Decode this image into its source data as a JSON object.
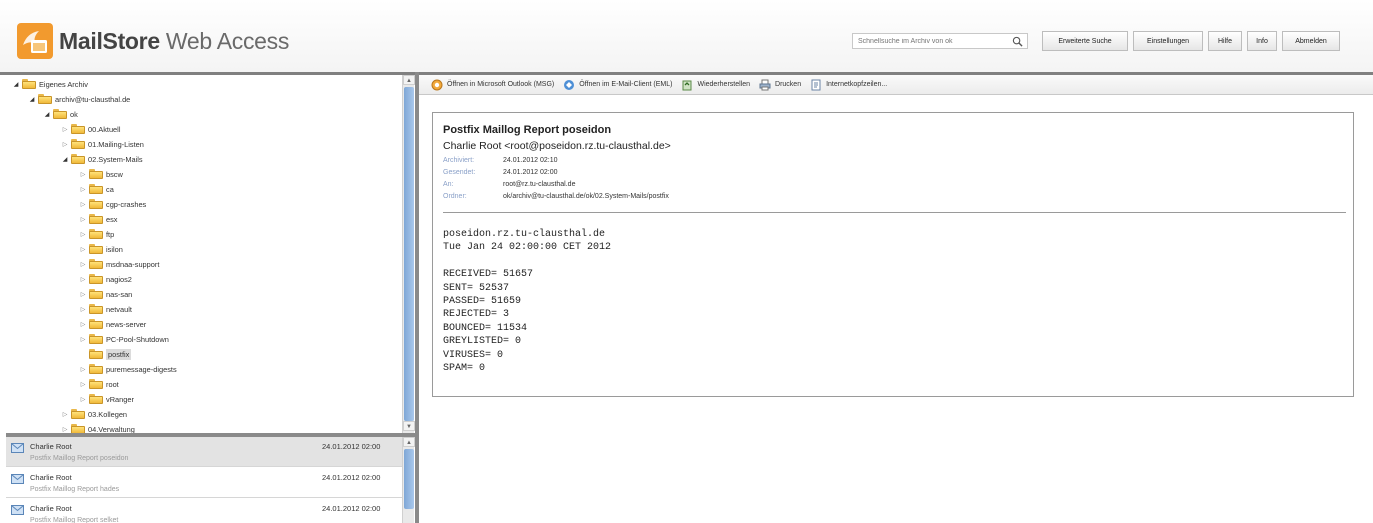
{
  "header": {
    "logo_bold": "MailStore",
    "logo_thin": "Web Access",
    "search_placeholder": "Schnellsuche im Archiv von ok",
    "buttons": [
      "Erweiterte Suche",
      "Einstellungen",
      "Hilfe",
      "Info",
      "Abmelden"
    ]
  },
  "tree": [
    {
      "label": "Eigenes Archiv",
      "depth": 0,
      "state": "open"
    },
    {
      "label": "archiv@tu-clausthal.de",
      "depth": 1,
      "state": "open"
    },
    {
      "label": "ok",
      "depth": 2,
      "state": "open"
    },
    {
      "label": "00.Aktuell",
      "depth": 3,
      "state": "closed"
    },
    {
      "label": "01.Mailing-Listen",
      "depth": 3,
      "state": "closed"
    },
    {
      "label": "02.System-Mails",
      "depth": 3,
      "state": "open"
    },
    {
      "label": "bscw",
      "depth": 4,
      "state": "closed"
    },
    {
      "label": "ca",
      "depth": 4,
      "state": "closed"
    },
    {
      "label": "cgp-crashes",
      "depth": 4,
      "state": "closed"
    },
    {
      "label": "esx",
      "depth": 4,
      "state": "closed"
    },
    {
      "label": "ftp",
      "depth": 4,
      "state": "closed"
    },
    {
      "label": "isilon",
      "depth": 4,
      "state": "closed"
    },
    {
      "label": "msdnaa-support",
      "depth": 4,
      "state": "closed"
    },
    {
      "label": "nagios2",
      "depth": 4,
      "state": "closed"
    },
    {
      "label": "nas-san",
      "depth": 4,
      "state": "closed"
    },
    {
      "label": "netvault",
      "depth": 4,
      "state": "closed"
    },
    {
      "label": "news-server",
      "depth": 4,
      "state": "closed"
    },
    {
      "label": "PC-Pool-Shutdown",
      "depth": 4,
      "state": "closed"
    },
    {
      "label": "postfix",
      "depth": 4,
      "state": "leaf",
      "selected": true
    },
    {
      "label": "puremessage-digests",
      "depth": 4,
      "state": "closed"
    },
    {
      "label": "root",
      "depth": 4,
      "state": "closed"
    },
    {
      "label": "vRanger",
      "depth": 4,
      "state": "closed"
    },
    {
      "label": "03.Kollegen",
      "depth": 3,
      "state": "closed"
    },
    {
      "label": "04.Verwaltung",
      "depth": 3,
      "state": "closed"
    }
  ],
  "mails": [
    {
      "from": "Charlie Root",
      "date": "24.01.2012 02:00",
      "subject": "Postfix Maillog Report poseidon",
      "selected": true
    },
    {
      "from": "Charlie Root",
      "date": "24.01.2012 02:00",
      "subject": "Postfix Maillog Report hades",
      "selected": false
    },
    {
      "from": "Charlie Root",
      "date": "24.01.2012 02:00",
      "subject": "Postfix Maillog Report selket",
      "selected": false
    }
  ],
  "toolbar": [
    {
      "label": "Öffnen in Microsoft Outlook (MSG)",
      "icon": "outlook-icon"
    },
    {
      "label": "Öffnen im E-Mail-Client (EML)",
      "icon": "email-client-icon"
    },
    {
      "label": "Wiederherstellen",
      "icon": "restore-icon"
    },
    {
      "label": "Drucken",
      "icon": "printer-icon"
    },
    {
      "label": "Internetkopfzeilen...",
      "icon": "headers-icon"
    }
  ],
  "message": {
    "subject": "Postfix Maillog Report poseidon",
    "from": "Charlie Root <root@poseidon.rz.tu-clausthal.de>",
    "meta": [
      {
        "key": "Archiviert:",
        "value": "24.01.2012 02:10"
      },
      {
        "key": "Gesendet:",
        "value": "24.01.2012 02:00"
      },
      {
        "key": "An:",
        "value": "root@rz.tu-clausthal.de"
      },
      {
        "key": "Ordner:",
        "value": "ok/archiv@tu-clausthal.de/ok/02.System-Mails/postfix"
      }
    ],
    "body": "poseidon.rz.tu-clausthal.de\nTue Jan 24 02:00:00 CET 2012\n\nRECEIVED= 51657\nSENT= 52537\nPASSED= 51659\nREJECTED= 3\nBOUNCED= 11534\nGREYLISTED= 0\nVIRUSES= 0\nSPAM= 0"
  },
  "colors": {
    "accent_blue": "#7fa7d6",
    "logo_orange": "#f29a2e",
    "meta_key": "#8aa0c8"
  }
}
